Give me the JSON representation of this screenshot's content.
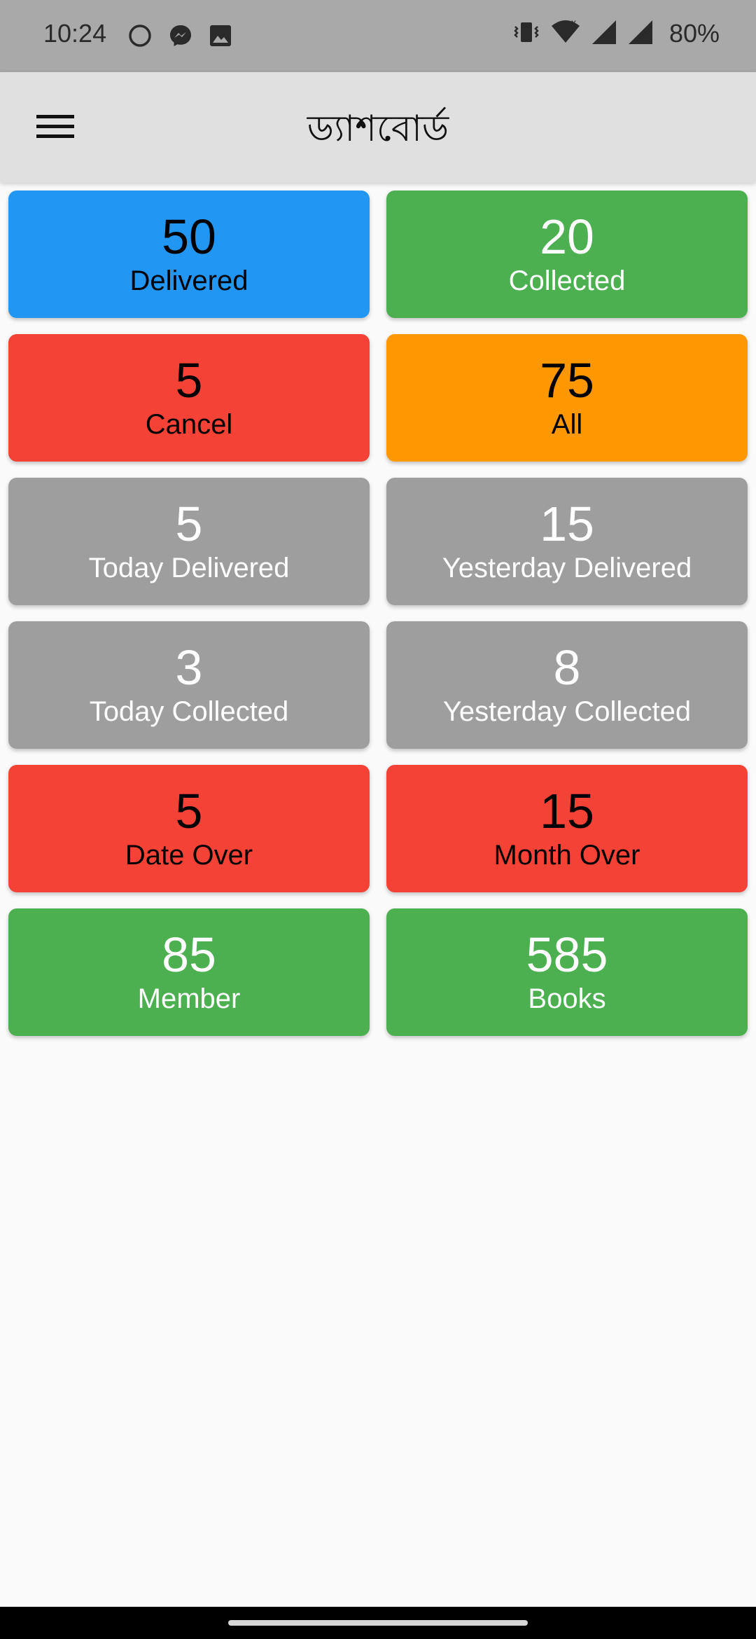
{
  "status_bar": {
    "time": "10:24",
    "battery": "80%",
    "icons_left": [
      "circle-icon",
      "messenger-icon",
      "image-icon"
    ],
    "icons_right": [
      "vibrate-icon",
      "wifi-icon",
      "signal-icon",
      "signal-icon"
    ]
  },
  "app_bar": {
    "title": "ড্যাশবোর্ড",
    "menu_icon": "hamburger-menu-icon"
  },
  "colors": {
    "blue": "#2196F3",
    "green": "#4CAF50",
    "red": "#F44336",
    "orange": "#FF9800",
    "grey": "#9E9E9E"
  },
  "cards": [
    {
      "value": "50",
      "label": "Delivered",
      "color": "#2196F3",
      "text_color": "#000000"
    },
    {
      "value": "20",
      "label": "Collected",
      "color": "#4CAF50",
      "text_color": "#ffffff"
    },
    {
      "value": "5",
      "label": "Cancel",
      "color": "#F44336",
      "text_color": "#000000"
    },
    {
      "value": "75",
      "label": "All",
      "color": "#FF9800",
      "text_color": "#000000"
    },
    {
      "value": "5",
      "label": "Today Delivered",
      "color": "#9E9E9E",
      "text_color": "#ffffff"
    },
    {
      "value": "15",
      "label": "Yesterday Delivered",
      "color": "#9E9E9E",
      "text_color": "#ffffff"
    },
    {
      "value": "3",
      "label": "Today Collected",
      "color": "#9E9E9E",
      "text_color": "#ffffff"
    },
    {
      "value": "8",
      "label": "Yesterday Collected",
      "color": "#9E9E9E",
      "text_color": "#ffffff"
    },
    {
      "value": "5",
      "label": "Date Over",
      "color": "#F44336",
      "text_color": "#000000"
    },
    {
      "value": "15",
      "label": "Month Over",
      "color": "#F44336",
      "text_color": "#000000"
    },
    {
      "value": "85",
      "label": "Member",
      "color": "#4CAF50",
      "text_color": "#ffffff"
    },
    {
      "value": "585",
      "label": "Books",
      "color": "#4CAF50",
      "text_color": "#ffffff"
    }
  ]
}
